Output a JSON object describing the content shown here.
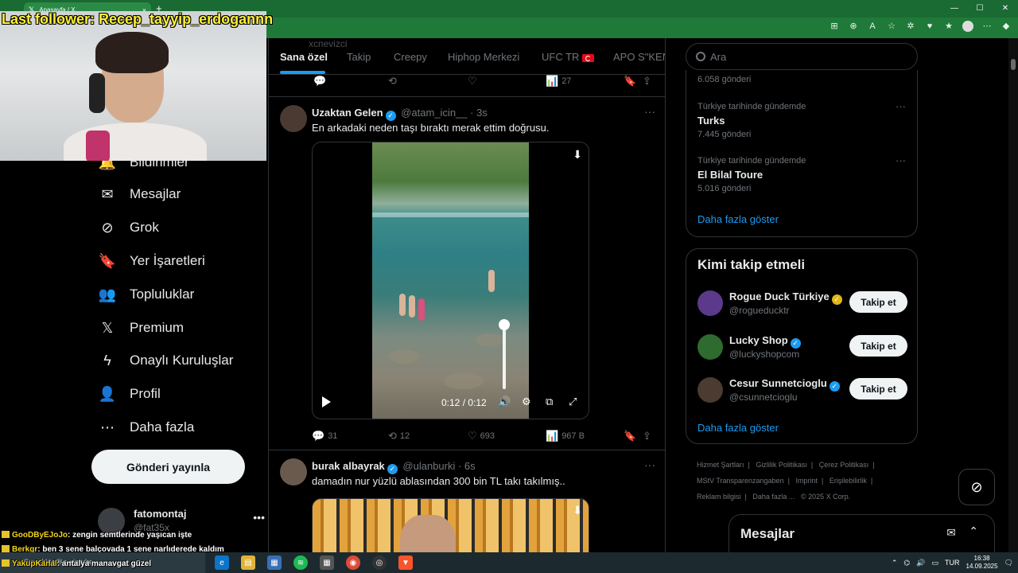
{
  "browser": {
    "tab_title": "Anasayfa / X",
    "window_controls": [
      "—",
      "☐",
      "✕"
    ]
  },
  "stream": {
    "last_follower": "Last follower: Recep_tayyip_erdogannn",
    "chat": [
      {
        "user": "GooDByEJoJo",
        "text": ": zengin semtlerinde yaşıcan işte"
      },
      {
        "user": "Berkgr",
        "text": ": ben 3 sene balçovada 1 sene narlıderede kaldım"
      },
      {
        "user": "YakupKanal",
        "text": ": antalya manavgat güzel"
      }
    ]
  },
  "nav": {
    "items": [
      {
        "label": "Bildirimler",
        "icon": "bell-icon"
      },
      {
        "label": "Mesajlar",
        "icon": "mail-icon"
      },
      {
        "label": "Grok",
        "icon": "grok-icon"
      },
      {
        "label": "Yer İşaretleri",
        "icon": "bookmark-icon"
      },
      {
        "label": "Topluluklar",
        "icon": "communities-icon"
      },
      {
        "label": "Premium",
        "icon": "x-logo-icon"
      },
      {
        "label": "Onaylı Kuruluşlar",
        "icon": "lightning-icon"
      },
      {
        "label": "Profil",
        "icon": "person-icon"
      },
      {
        "label": "Daha fazla",
        "icon": "more-circle-icon"
      }
    ],
    "post_button": "Gönderi yayınla",
    "account": {
      "name": "fatomontaj",
      "handle": "@fat35x"
    }
  },
  "feed": {
    "ghost_title": "xспеvizci",
    "tabs": [
      "Sana özel",
      "Takip",
      "Creepy",
      "Hiphop Merkezi",
      "UFC TR",
      "APO S\"KEN"
    ],
    "prev_actions": {
      "views": "27"
    },
    "tweets": [
      {
        "name": "Uzaktan Gelen",
        "handle": "@atam_icin__",
        "time": "· 3s",
        "text": "En arkadaki neden taşı bıraktı merak ettim doğrusu.",
        "video_time": "0:12 / 0:12",
        "replies": "31",
        "retweets": "12",
        "likes": "693",
        "views": "967 B"
      },
      {
        "name": "burak albayrak",
        "handle": "@ulanburki",
        "time": "· 6s",
        "text": "damadın nur yüzlü ablasından 300 bin TL takı takılmış.."
      }
    ]
  },
  "right": {
    "search_placeholder": "Ara",
    "trends": [
      {
        "meta": "",
        "name": "",
        "posts": "6.058 gönderi"
      },
      {
        "meta": "Türkiye tarihinde gündemde",
        "name": "Turks",
        "posts": "7.445 gönderi"
      },
      {
        "meta": "Türkiye tarihinde gündemde",
        "name": "El Bilal Toure",
        "posts": "5.016 gönderi"
      }
    ],
    "show_more": "Daha fazla göster",
    "who_to_follow_title": "Kimi takip etmeli",
    "who_to_follow": [
      {
        "name": "Rogue Duck Türkiye",
        "handle": "@rogueducktr",
        "badge": "gold",
        "avatar_color": "#5b3a8c"
      },
      {
        "name": "Lucky Shop",
        "handle": "@luckyshopcom",
        "badge": "blue",
        "avatar_color": "#2e6b2f"
      },
      {
        "name": "Cesur Sunnetcioglu",
        "handle": "@csunnetcioglu",
        "badge": "blue",
        "avatar_color": "#4b3b30"
      }
    ],
    "follow_label": "Takip et",
    "show_more_2": "Daha fazla göster",
    "footer": [
      "Hizmet Şartları",
      "|",
      "Gizlilik Politikası",
      "|",
      "Çerez Politikası",
      "|",
      "MStV Transparenzangaben",
      "|",
      "Imprint",
      "|",
      "Erişilebilirlik",
      "|",
      "Reklam bilgisi",
      "|",
      "Daha fazla ...",
      "© 2025 X Corp."
    ],
    "messages_drawer": "Mesajlar"
  },
  "taskbar": {
    "search_text": "Sıcaklıkta fiks sinerbe",
    "lang": "TUR",
    "time": "16:38",
    "date": "14.09.2025"
  },
  "colors": {
    "accent": "#1d9bf0",
    "browser_green": "#1f7a3a",
    "overlay_yellow": "#fff135"
  }
}
